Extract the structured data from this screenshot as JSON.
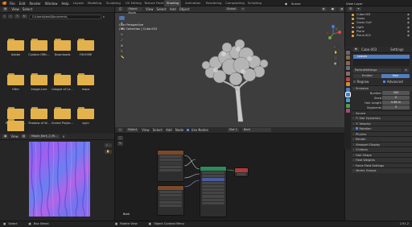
{
  "top_menu": [
    "File",
    "Edit",
    "Render",
    "Window",
    "Help"
  ],
  "workspaces": [
    "Layout",
    "Modeling",
    "Sculpting",
    "UV Editing",
    "Texture Paint",
    "Shading",
    "Animation",
    "Rendering",
    "Compositing",
    "Scripting"
  ],
  "active_workspace": "Shading",
  "scene": "Scene",
  "view_layer": "View Layer",
  "file_browser": {
    "menu": [
      "View",
      "Select"
    ],
    "path": "C:\\Users\\Ideal\\Documents\\",
    "folders": [
      "Adobe",
      "Custom Offic...",
      "Downloads",
      "FXHOME",
      "Hitm",
      "Image-Line",
      "League of Le...",
      "maps",
      "Rockstar Ga...",
      "Shadow of W...",
      "Unreal Projec...",
      "vgcn"
    ]
  },
  "image_editor": {
    "menu": [
      "View"
    ],
    "image_name": "Maple_Bark_2_Ml..."
  },
  "viewport": {
    "mode": "Object Mode",
    "menu": [
      "View",
      "Select",
      "Add",
      "Object"
    ],
    "orientation": "Global",
    "info_line1": "User Perspective",
    "info_line2": "(38) Collection | Cube.003",
    "shading_label": "Options"
  },
  "node_editor": {
    "type": "Object",
    "menu": [
      "View",
      "Select",
      "Add",
      "Node"
    ],
    "use_nodes": "Use Nodes",
    "slot": "Slot 1",
    "material": "Bark",
    "material_label": "Bark"
  },
  "outliner": {
    "items": [
      {
        "name": "Cube.003",
        "color": "#e9a24a"
      },
      {
        "name": "Grass",
        "color": "#e9a24a"
      },
      {
        "name": "Grass Surf",
        "color": "#e9a24a"
      },
      {
        "name": "Light",
        "color": "#e9a24a"
      },
      {
        "name": "Plane",
        "color": "#e9a24a"
      },
      {
        "name": "Plane.002",
        "color": "#e9a24a"
      }
    ]
  },
  "properties": {
    "object": "Cube.003",
    "settings_tab": "Settings",
    "system_name": "Leaves",
    "particle_settings": "ParticleSettings",
    "emitter": "Emitter",
    "hair": "Hair",
    "regrow": "Regrow",
    "advanced": "Advanced",
    "emission_header": "Emission",
    "fields": [
      {
        "label": "Number",
        "value": "200"
      },
      {
        "label": "Seed",
        "value": "0"
      },
      {
        "label": "Hair Length",
        "value": "0.68 m"
      },
      {
        "label": "Segments",
        "value": "5"
      }
    ],
    "source": "Source",
    "sections": [
      "Hair Dynamics",
      "Velocity",
      "Rotation",
      "Physics",
      "Render",
      "Viewport Display",
      "Children",
      "Hair Shape",
      "Field Weights",
      "Force Field Settings",
      "Vertex Groups"
    ],
    "checked_sections": [
      "Rotation"
    ]
  },
  "status_bar": {
    "select": "Select",
    "box_select": "Box Select",
    "rotate": "Rotate View",
    "context": "Object Context Menu",
    "version": "2.91.2"
  }
}
